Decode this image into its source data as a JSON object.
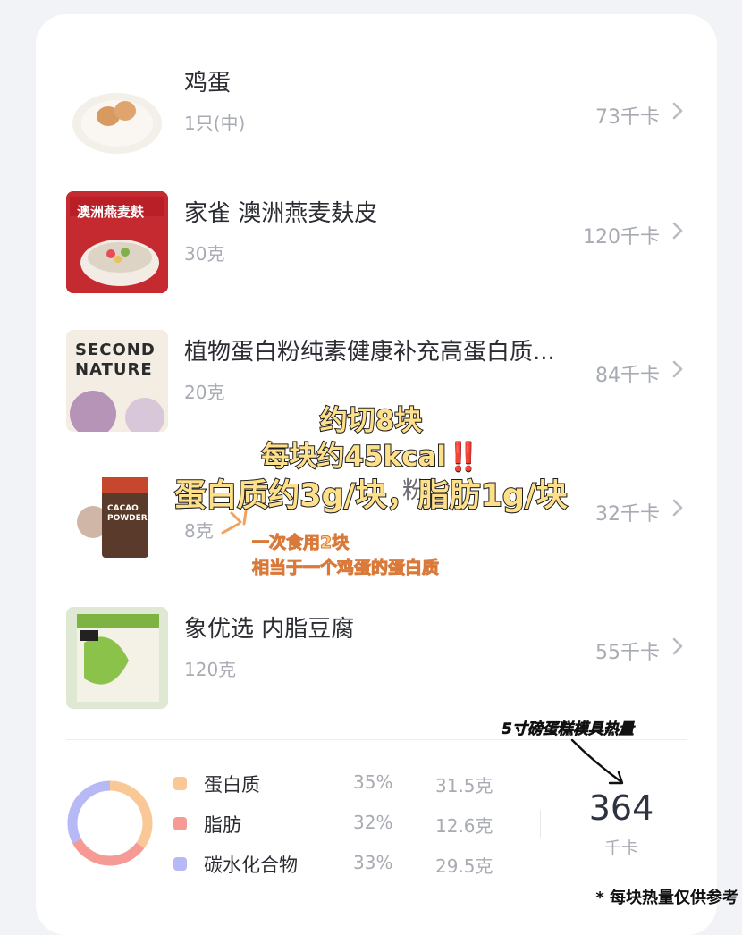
{
  "foods": [
    {
      "name": "鸡蛋",
      "qty": "1只(中)",
      "kcal": "73千卡",
      "icon": "egg-plate-image"
    },
    {
      "name": "家雀 澳洲燕麦麸皮",
      "qty": "30克",
      "kcal": "120千卡",
      "icon": "oat-bran-package-image",
      "pkg_text": "澳洲燕麦麸"
    },
    {
      "name": "植物蛋白粉纯素健康补充高蛋白质...",
      "qty": "20克",
      "kcal": "84千卡",
      "icon": "protein-powder-package-image",
      "pkg_text": [
        "SECOND",
        "NATURE"
      ]
    },
    {
      "name": "",
      "qty": "8克",
      "kcal": "32千卡",
      "icon": "cacao-powder-package-image",
      "pkg_text": [
        "CACAO",
        "POWDER"
      ],
      "name_partial": "粉"
    },
    {
      "name": "象优选 内脂豆腐",
      "qty": "120克",
      "kcal": "55千卡",
      "icon": "tofu-package-image"
    }
  ],
  "macros": [
    {
      "name": "蛋白质",
      "pct": "35%",
      "grams": "31.5克",
      "color": "#fac896",
      "fraction": 0.35
    },
    {
      "name": "脂肪",
      "pct": "32%",
      "grams": "12.6克",
      "color": "#f59a94",
      "fraction": 0.32
    },
    {
      "name": "碳水化合物",
      "pct": "33%",
      "grams": "29.5克",
      "color": "#b7b8f6",
      "fraction": 0.33
    }
  ],
  "total": {
    "value": "364",
    "unit": "千卡"
  },
  "overlay": {
    "line1": "约切8块",
    "line2": "每块约45kcal",
    "line2_mark": "‼️",
    "line3": "蛋白质约3g/块，脂肪1g/块",
    "note1": "一次食用2块",
    "note2": "相当于一个鸡蛋的蛋白质",
    "handwritten_label": "5寸磅蛋糕模具热量",
    "footnote": "* 每块热量仅供参考"
  }
}
